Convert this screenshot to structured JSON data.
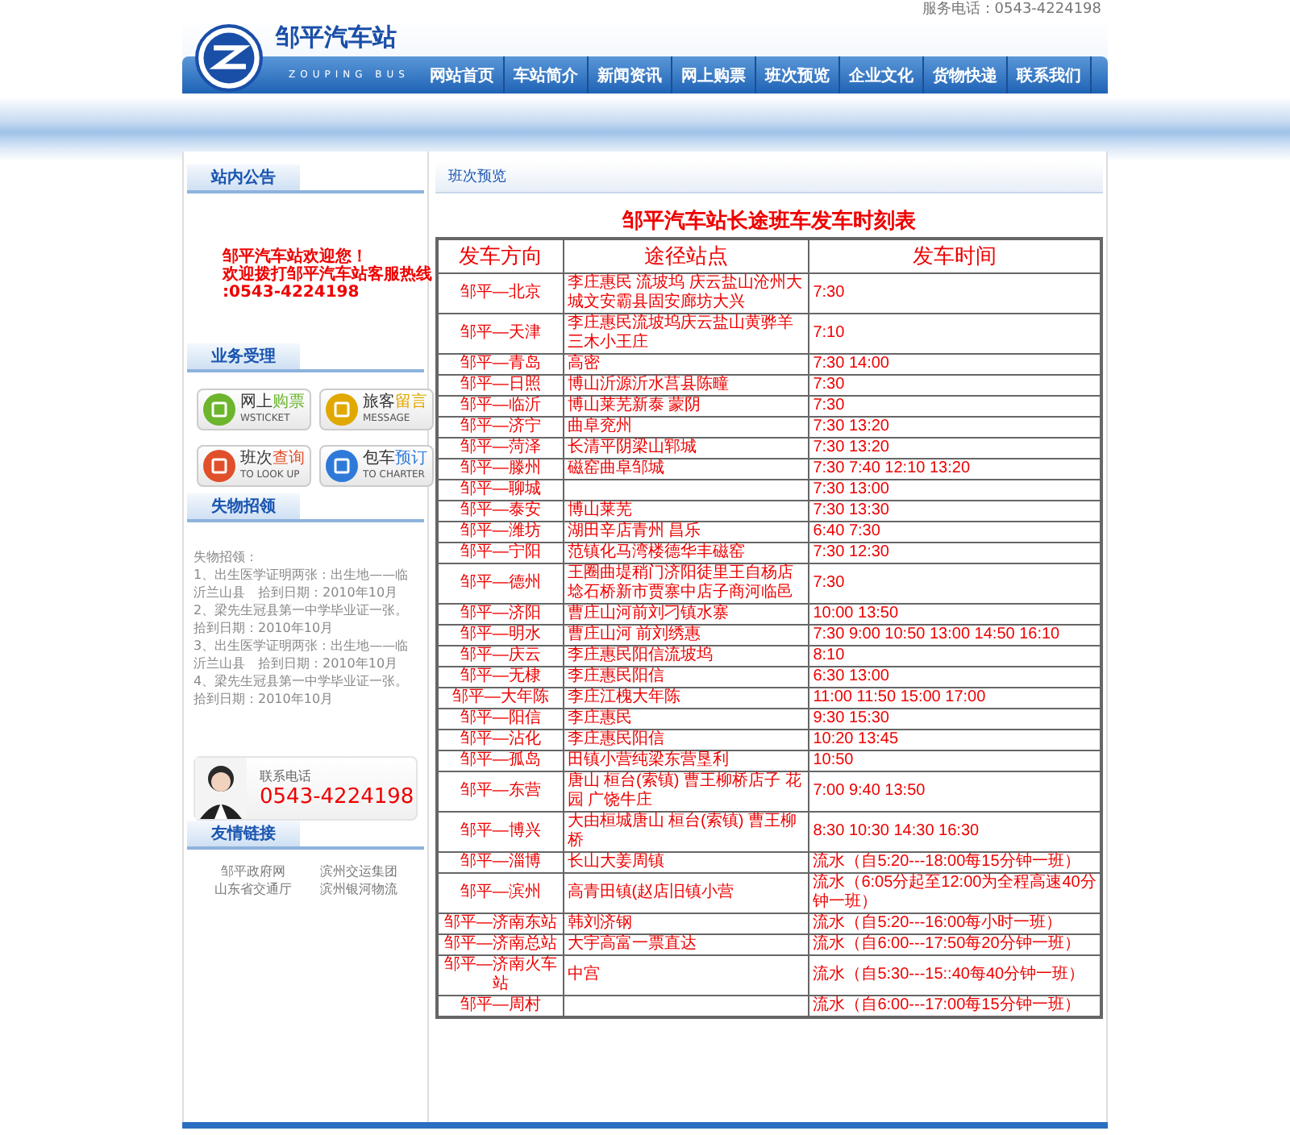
{
  "top_bar": {
    "phone": "服务电话：0543-4224198"
  },
  "logo": {
    "name": "邹平汽车站",
    "subtitle": "ZOUPING BUS"
  },
  "nav": [
    {
      "label": "网站首页"
    },
    {
      "label": "车站简介"
    },
    {
      "label": "新闻资讯"
    },
    {
      "label": "网上购票"
    },
    {
      "label": "班次预览"
    },
    {
      "label": "企业文化"
    },
    {
      "label": "货物快递"
    },
    {
      "label": "联系我们"
    }
  ],
  "sidebar": {
    "notice": {
      "title": "站内公告",
      "lines": [
        "邹平汽车站欢迎您！",
        "欢迎拨打邹平汽车站客服热线",
        ":0543-4224198"
      ]
    },
    "services": {
      "title": "业务受理",
      "items": [
        {
          "title_1": "网上",
          "title_2": "购票",
          "subtitle": "WSTICKET",
          "color": "#6cb52d"
        },
        {
          "title_1": "旅客",
          "title_2": "留言",
          "subtitle": "MESSAGE",
          "color": "#e0a800"
        },
        {
          "title_1": "班次",
          "title_2": "查询",
          "subtitle": "TO LOOK UP",
          "color": "#e0502a"
        },
        {
          "title_1": "包车",
          "title_2": "预订",
          "subtitle": "TO CHARTER",
          "color": "#2f7ad8"
        }
      ]
    },
    "lost": {
      "title": "失物招领",
      "intro": "失物招领：",
      "items": [
        "1、出生医学证明两张：出生地——临沂兰山县　拾到日期：2010年10月",
        "2、梁先生冠县第一中学毕业证一张。拾到日期：2010年10月",
        "3、出生医学证明两张：出生地——临沂兰山县　拾到日期：2010年10月",
        "4、梁先生冠县第一中学毕业证一张。拾到日期：2010年10月"
      ]
    },
    "contact": {
      "label": "联系电话",
      "phone": "0543-4224198"
    },
    "links": {
      "title": "友情链接",
      "items": [
        "邹平政府网",
        "滨州交运集团",
        "山东省交通厅",
        "滨州银河物流"
      ]
    }
  },
  "main": {
    "tab": "班次预览",
    "table_title": "邹平汽车站长途班车发车时刻表",
    "columns": [
      "发车方向",
      "途径站点",
      "发车时间"
    ],
    "rows": [
      [
        "邹平—北京",
        "李庄惠民 流坡坞 庆云盐山沧州大城文安霸县固安廊坊大兴",
        "7:30"
      ],
      [
        "邹平—天津",
        "李庄惠民流坡坞庆云盐山黄骅羊三木小王庄",
        "7:10"
      ],
      [
        "邹平—青岛",
        "高密",
        "7:30 14:00"
      ],
      [
        "邹平—日照",
        "博山沂源沂水莒县陈疃",
        "7:30"
      ],
      [
        "邹平—临沂",
        "博山莱芜新泰 蒙阴",
        "7:30"
      ],
      [
        "邹平—济宁",
        "曲阜兖州",
        "7:30 13:20"
      ],
      [
        "邹平—菏泽",
        "长清平阴梁山郓城",
        "7:30 13:20"
      ],
      [
        "邹平—滕州",
        "磁窑曲阜邹城",
        "7:30 7:40  12:10 13:20"
      ],
      [
        "邹平—聊城",
        "",
        "7:30 13:00"
      ],
      [
        "邹平—泰安",
        "博山莱芜",
        "7:30 13:30"
      ],
      [
        "邹平—潍坊",
        "湖田辛店青州 昌乐",
        "6:40 7:30"
      ],
      [
        "邹平—宁阳",
        "范镇化马湾楼德华丰磁窑",
        "7:30 12:30"
      ],
      [
        "邹平—德州",
        "王圈曲堤稍门济阳徒里王自杨店埝石桥新市贾寨中店子商河临邑",
        "7:30"
      ],
      [
        "邹平—济阳",
        "曹庄山河前刘刁镇水寨",
        "10:00 13:50"
      ],
      [
        "邹平—明水",
        "曹庄山河 前刘绣惠",
        "7:30 9:00 10:50 13:00 14:50 16:10"
      ],
      [
        "邹平—庆云",
        "李庄惠民阳信流坡坞",
        "8:10"
      ],
      [
        "邹平—无棣",
        "李庄惠民阳信",
        "6:30 13:00"
      ],
      [
        "邹平—大年陈",
        "李庄江槐大年陈",
        "11:00 11:50 15:00 17:00"
      ],
      [
        "邹平—阳信",
        "李庄惠民",
        "9:30 15:30"
      ],
      [
        "邹平—沾化",
        "李庄惠民阳信",
        "10:20 13:45"
      ],
      [
        "邹平—孤岛",
        "田镇小营纯梁东营垦利",
        "10:50"
      ],
      [
        "邹平—东营",
        "唐山 桓台(索镇) 曹王柳桥店子 花园 广饶牛庄",
        "7:00 9:40  13:50"
      ],
      [
        "邹平—博兴",
        "大由桓城唐山 桓台(索镇) 曹王柳桥",
        "8:30 10:30 14:30 16:30"
      ],
      [
        "邹平—淄博",
        "长山大姜周镇",
        "流水（自5:20---18:00每15分钟一班）"
      ],
      [
        "邹平—滨州",
        "高青田镇(赵店旧镇小营",
        "流水（6:05分起至12:00为全程高速40分钟一班）"
      ],
      [
        "邹平—济南东站",
        "韩刘济钢",
        "流水（自5:20---16:00每小时一班）"
      ],
      [
        "邹平—济南总站",
        "大宇高富一票直达",
        "流水（自6:00---17:50每20分钟一班）"
      ],
      [
        "邹平—济南火车站",
        "中宫",
        "流水（自5:30---15::40每40分钟一班）"
      ],
      [
        "邹平—周村",
        "",
        "流水（自6:00---17:00每15分钟一班）"
      ]
    ]
  }
}
